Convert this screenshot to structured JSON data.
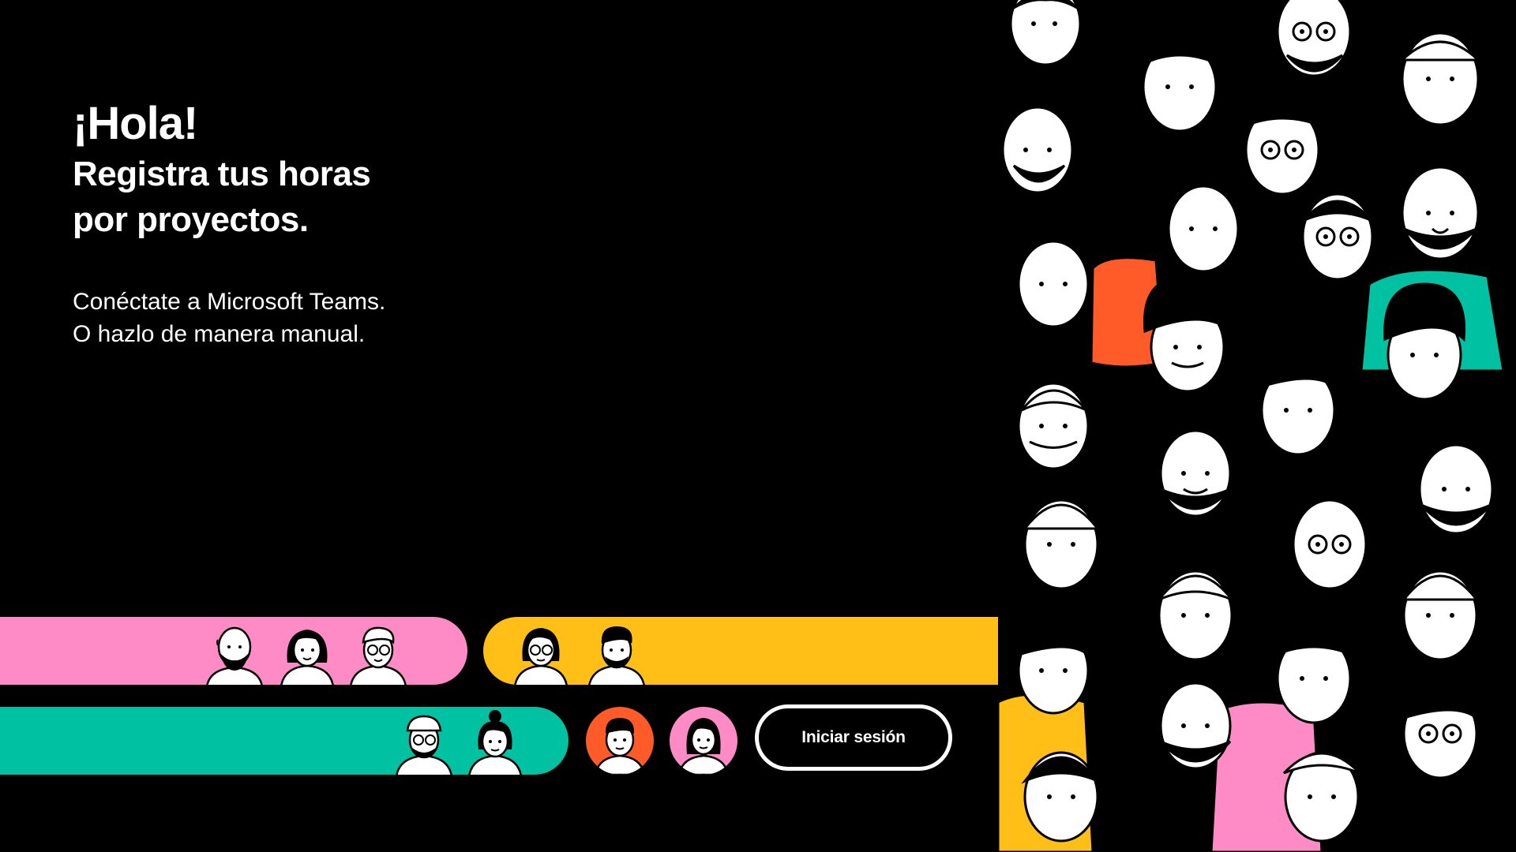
{
  "hero": {
    "greeting": "¡Hola!",
    "title_line1": "Registra tus horas",
    "title_line2": "por proyectos.",
    "sub_line1": "Conéctate a Microsoft Teams.",
    "sub_line2": "O hazlo de manera manual."
  },
  "actions": {
    "login_label": "Iniciar sesión"
  },
  "colors": {
    "background": "#000000",
    "pink": "#ff8bc6",
    "yellow": "#ffbf16",
    "teal": "#00c2a2",
    "orange": "#ff5b29",
    "text": "#ffffff"
  },
  "decor": {
    "bars": [
      "pink-bar",
      "yellow-bar",
      "teal-bar"
    ],
    "crowd": "crowd-illustration-icon"
  }
}
